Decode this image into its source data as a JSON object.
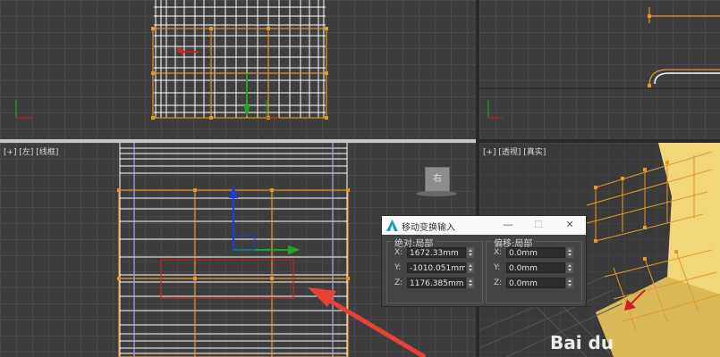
{
  "viewports": {
    "left": {
      "label": "[+] [左] [线框]"
    },
    "perspective": {
      "label": "[+] [透视] [真实]"
    }
  },
  "nav_cube": {
    "face": "右"
  },
  "dialog": {
    "title": "移动变换输入",
    "minimize": "—",
    "maximize": "☐",
    "close": "✕",
    "absolute": {
      "title": "绝对:局部",
      "x_label": "X:",
      "x_value": "1672.33mm",
      "y_label": "Y:",
      "y_value": "-1010.051mm",
      "z_label": "Z:",
      "z_value": "1176.385mm"
    },
    "offset": {
      "title": "偏移:局部",
      "x_label": "X:",
      "x_value": "0.0mm",
      "y_label": "Y:",
      "y_value": "0.0mm",
      "z_label": "Z:",
      "z_value": "0.0mm"
    }
  },
  "watermark": {
    "text": "Bai du"
  },
  "colors": {
    "viewport_bg": "#3d3d3d",
    "grid": "#4a4a4a",
    "mesh_white": "#ffffff",
    "mesh_orange": "#e19a2a",
    "selection_red": "#d02020",
    "arrow_red": "#e8413a",
    "axis_blue": "#1a3ee0",
    "axis_green": "#1fa81f",
    "model_yellow": "#f2d77a"
  }
}
